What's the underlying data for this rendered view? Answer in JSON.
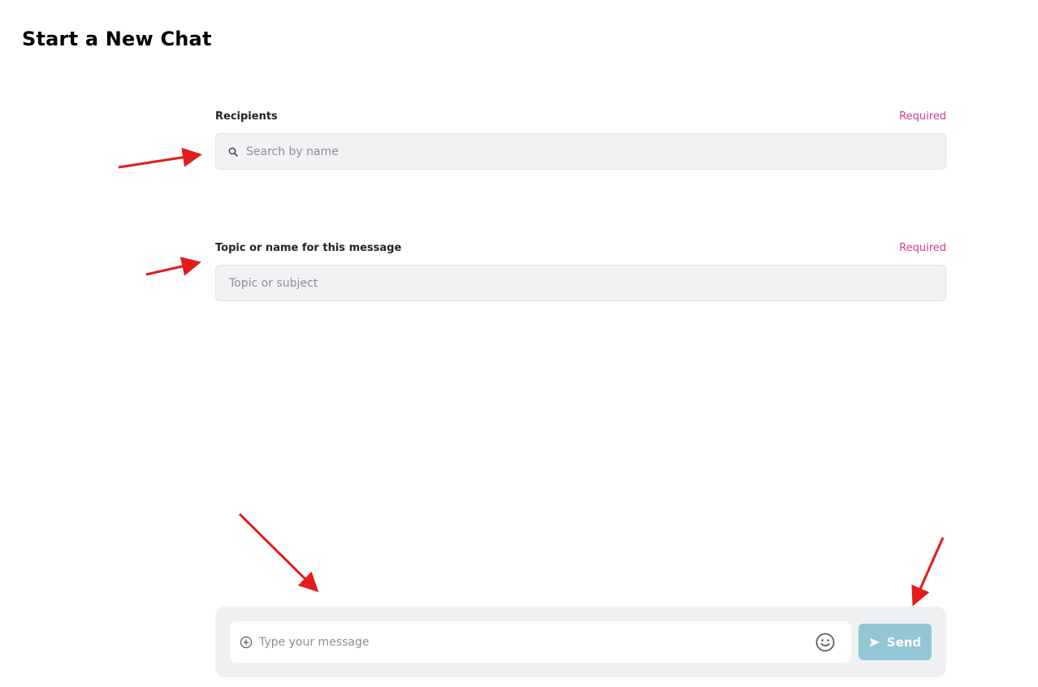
{
  "page": {
    "title": "Start a New Chat"
  },
  "recipients": {
    "label": "Recipients",
    "required": "Required",
    "placeholder": "Search by name",
    "icon": "search-icon"
  },
  "topic": {
    "label": "Topic or name for this message",
    "required": "Required",
    "placeholder": "Topic or subject"
  },
  "composer": {
    "placeholder": "Type your message",
    "attach_icon": "plus-circle-icon",
    "emoji_icon": "emoji-icon",
    "send_label": "Send",
    "send_icon": "send-icon"
  },
  "colors": {
    "required_text": "#d63a9a",
    "send_button": "#93c6d4",
    "input_background": "#f1f2f4",
    "composer_background": "#eff0f2",
    "annotation_arrow": "#e31b1b"
  }
}
